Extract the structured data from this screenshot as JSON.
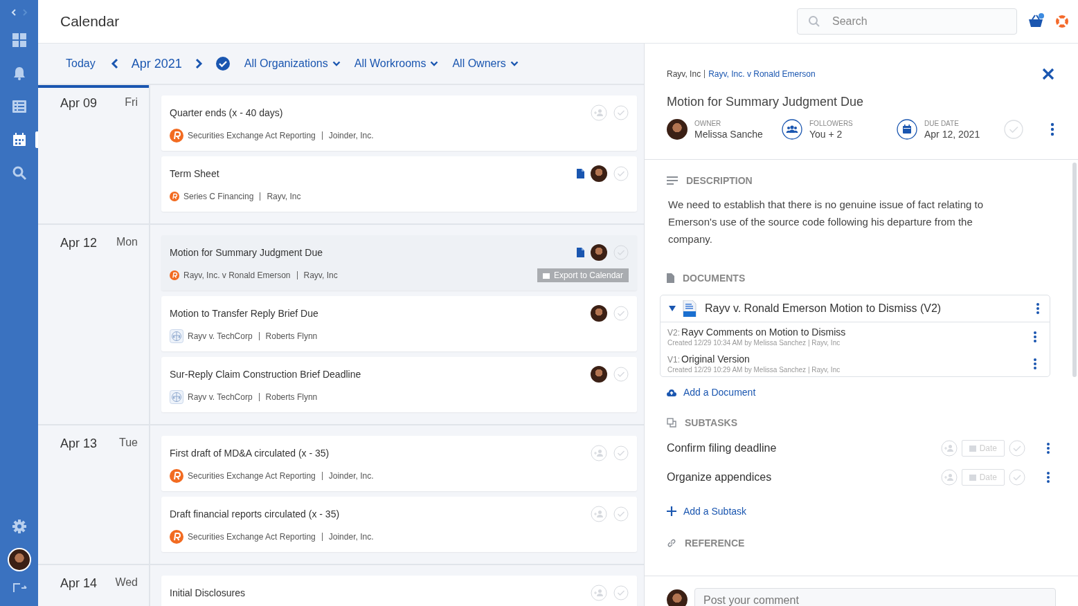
{
  "sidebar": {
    "items": [
      {
        "kind": "grid",
        "selected": false
      },
      {
        "kind": "bell",
        "selected": false
      },
      {
        "kind": "list",
        "selected": false
      },
      {
        "kind": "calendar",
        "selected": true
      },
      {
        "kind": "search",
        "selected": false
      }
    ],
    "bottom": [
      {
        "kind": "gear"
      },
      {
        "kind": "avatar"
      },
      {
        "kind": "logout"
      }
    ]
  },
  "header": {
    "title": "Calendar",
    "search": {
      "placeholder": "Search"
    }
  },
  "toolbar": {
    "today": "Today",
    "month": "Apr 2021",
    "filters": [
      "All Organizations",
      "All Workrooms",
      "All Owners"
    ]
  },
  "days": [
    {
      "date": "Apr 09",
      "weekday": "Fri",
      "selected": true,
      "events": [
        {
          "title": "Quarter ends (x - 40 days)",
          "matter": "Securities Exchange Act Reporting",
          "org": "Joinder, Inc.",
          "kind": "logo",
          "has_doc": false,
          "assigned": false,
          "hovered": false
        },
        {
          "title": "Term Sheet",
          "matter": "Series C Financing",
          "org": "Rayv, Inc",
          "kind": "logo-small",
          "has_doc": true,
          "assigned": true,
          "hovered": false
        }
      ]
    },
    {
      "date": "Apr 12",
      "weekday": "Mon",
      "selected": false,
      "events": [
        {
          "title": "Motion for Summary Judgment Due",
          "matter": "Rayv, Inc. v Ronald Emerson",
          "org": "Rayv, Inc",
          "kind": "logo-small",
          "has_doc": true,
          "assigned": true,
          "hovered": true,
          "export": "Export to Calendar"
        },
        {
          "title": "Motion to Transfer Reply Brief Due",
          "matter": "Rayv v. TechCorp",
          "org": "Roberts Flynn",
          "kind": "scale",
          "has_doc": false,
          "assigned": true,
          "hovered": false
        },
        {
          "title": "Sur-Reply Claim Construction Brief Deadline",
          "matter": "Rayv v. TechCorp",
          "org": "Roberts Flynn",
          "kind": "scale",
          "has_doc": false,
          "assigned": true,
          "hovered": false
        }
      ]
    },
    {
      "date": "Apr 13",
      "weekday": "Tue",
      "selected": false,
      "events": [
        {
          "title": "First draft of MD&A circulated (x - 35)",
          "matter": "Securities Exchange Act Reporting",
          "org": "Joinder, Inc.",
          "kind": "logo",
          "has_doc": false,
          "assigned": false,
          "hovered": false
        },
        {
          "title": "Draft financial reports circulated (x - 35)",
          "matter": "Securities Exchange Act Reporting",
          "org": "Joinder, Inc.",
          "kind": "logo",
          "has_doc": false,
          "assigned": false,
          "hovered": false
        }
      ]
    },
    {
      "date": "Apr 14",
      "weekday": "Wed",
      "selected": false,
      "events": [
        {
          "title": "Initial Disclosures",
          "has_doc": false,
          "assigned": false,
          "hovered": false
        }
      ]
    }
  ],
  "detail": {
    "org": "Rayv, Inc",
    "matter": "Rayv, Inc. v Ronald Emerson",
    "title": "Motion for Summary Judgment Due",
    "owner": {
      "label": "OWNER",
      "value": "Melissa Sanche"
    },
    "followers": {
      "label": "FOLLOWERS",
      "value": "You + 2"
    },
    "due": {
      "label": "DUE DATE",
      "value": "Apr 12, 2021"
    },
    "description": {
      "heading": "DESCRIPTION",
      "text": "We need to establish that there is no genuine issue of fact relating to Emerson's use of the source code following his departure from the company."
    },
    "documents": {
      "heading": "DOCUMENTS",
      "file": {
        "name": "Rayv v. Ronald Emerson Motion to Dismiss (V2)",
        "expanded": true,
        "versions": [
          {
            "tag": "V2:",
            "name": "Rayv Comments on Motion to Dismiss",
            "meta": "Created 12/29 10:34 AM by Melissa Sanchez | Rayv, Inc"
          },
          {
            "tag": "V1:",
            "name": "Original Version",
            "meta": "Created 12/29 10:29 AM by Melissa Sanchez | Rayv, Inc"
          }
        ]
      },
      "add": "Add a Document"
    },
    "subtasks": {
      "heading": "SUBTASKS",
      "items": [
        {
          "name": "Confirm filing deadline",
          "date": "Date"
        },
        {
          "name": "Organize appendices",
          "date": "Date"
        }
      ],
      "add": "Add a Subtask"
    },
    "reference": {
      "heading": "REFERENCE"
    },
    "comment": {
      "placeholder": "Post your comment"
    }
  }
}
